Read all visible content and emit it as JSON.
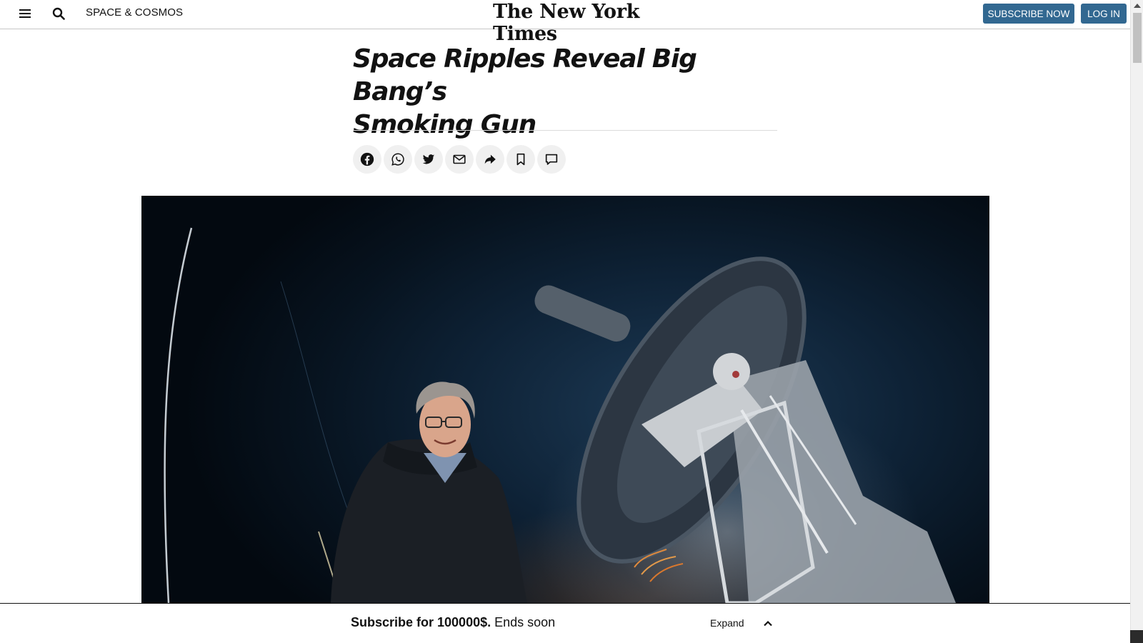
{
  "header": {
    "section": "SPACE & COSMOS",
    "logo": "The New York Times",
    "subscribe_label": "SUBSCRIBE NOW",
    "login_label": "LOG IN"
  },
  "article": {
    "title_line1": "Space Ripples Reveal Big Bang’s",
    "title_line2": "Smoking Gun"
  },
  "share": {
    "items": [
      "facebook",
      "whatsapp",
      "twitter",
      "email",
      "share",
      "bookmark",
      "comment"
    ]
  },
  "subscribe_bar": {
    "offer_bold": "Subscribe for 100000$.",
    "offer_rest": " Ends soon",
    "expand_label": "Expand"
  },
  "colors": {
    "brand_blue": "#326891",
    "text": "#121212"
  }
}
